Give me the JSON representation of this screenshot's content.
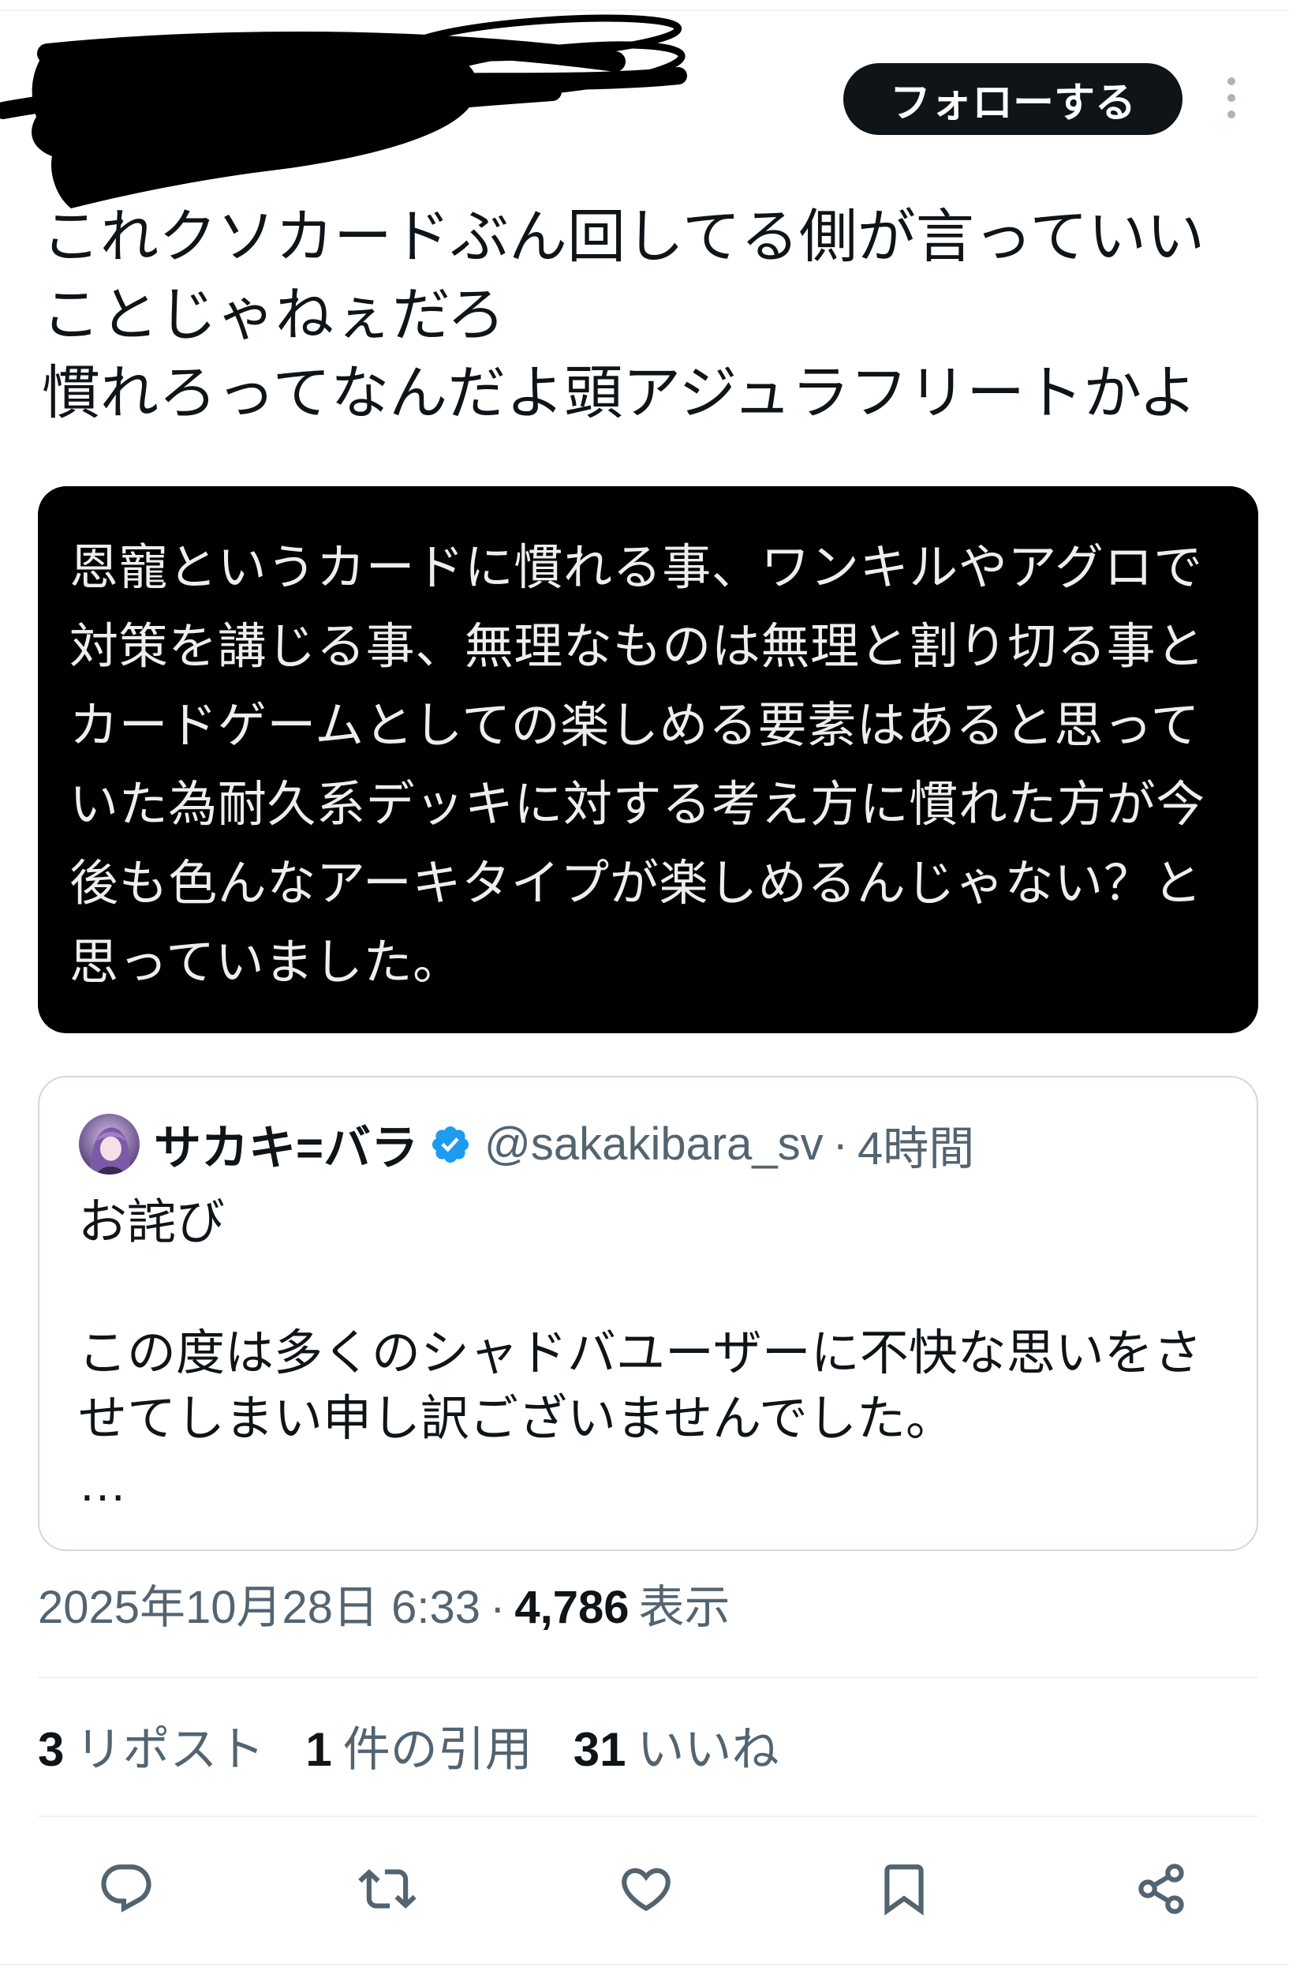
{
  "header": {
    "follow_label": "フォローする",
    "more_icon": "more-vertical-icon"
  },
  "tweet": {
    "text_lines": [
      "これクソカードぶん回してる側が言っていい",
      "ことじゃねぇだろ",
      "慣れろってなんだよ頭アジュラフリートかよ"
    ],
    "media": {
      "text_lines": [
        "恩寵というカードに慣れる事、ワンキルやアグロで",
        "対策を講じる事、無理なものは無理と割り切る事と",
        "カードゲームとしての楽しめる要素はあると思って",
        "いた為耐久系デッキに対する考え方に慣れた方が今",
        "後も色んなアーキタイプが楽しめるんじゃない？と",
        "思っていました。"
      ]
    },
    "quote": {
      "display_name": "サカキ=バラ",
      "verified_icon": "verified-badge-icon",
      "handle": "@sakakibara_sv",
      "separator": "·",
      "time": "4時間",
      "title": "お詫び",
      "body_lines": [
        "この度は多くのシャドバユーザーに不快な思いをさ",
        "せてしまい申し訳ございませんでした。"
      ],
      "truncation": "…"
    },
    "timestamp": "2025年10月28日 6:33",
    "separator": "·",
    "views_count": "4,786",
    "views_label": "表示"
  },
  "stats": [
    {
      "count": "3",
      "label": "リポスト"
    },
    {
      "count": "1",
      "label": "件の引用"
    },
    {
      "count": "31",
      "label": "いいね"
    }
  ],
  "actions": {
    "icons": [
      "reply-icon",
      "retweet-icon",
      "like-icon",
      "bookmark-icon",
      "share-icon"
    ]
  },
  "colors": {
    "text_primary": "#0f1419",
    "text_secondary": "#536471",
    "follow_button": "#0f1419",
    "verified": "#1d9bf0",
    "media_background": "#000000",
    "divider": "#eff3f4"
  }
}
